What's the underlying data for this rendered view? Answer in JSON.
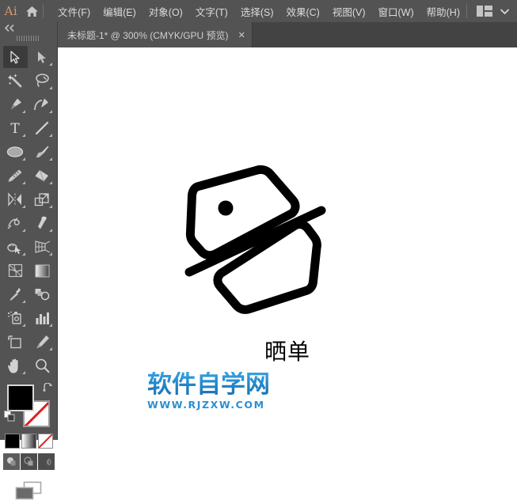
{
  "app": {
    "logo_text": "Ai",
    "home_icon": "home-icon",
    "title": "Adobe Illustrator"
  },
  "menubar": {
    "items": [
      {
        "label": "文件(F)",
        "name": "menu-file"
      },
      {
        "label": "编辑(E)",
        "name": "menu-edit"
      },
      {
        "label": "对象(O)",
        "name": "menu-object"
      },
      {
        "label": "文字(T)",
        "name": "menu-type"
      },
      {
        "label": "选择(S)",
        "name": "menu-select"
      },
      {
        "label": "效果(C)",
        "name": "menu-effect"
      },
      {
        "label": "视图(V)",
        "name": "menu-view"
      },
      {
        "label": "窗口(W)",
        "name": "menu-window"
      },
      {
        "label": "帮助(H)",
        "name": "menu-help"
      }
    ],
    "workspace_icon": "workspace-switcher-icon",
    "workspace_chevron": "chevron-down-icon",
    "bg_color": "#535353",
    "text_color": "#dcdcdc",
    "logo_color": "#d89a6c"
  },
  "tabbar": {
    "bg_color": "#434343",
    "tabs": [
      {
        "label": "未标题-1* @ 300% (CMYK/GPU 预览)",
        "close_glyph": "✕",
        "active": true
      }
    ]
  },
  "toolbar": {
    "collapse_glyph": "◀◀",
    "bg_color": "#535353",
    "active_tool": "selection-tool",
    "tools": [
      {
        "name": "selection-tool",
        "label": "选择工具",
        "corner": false,
        "active": true
      },
      {
        "name": "direct-selection-tool",
        "label": "直接选择工具",
        "corner": true,
        "active": false
      },
      {
        "name": "magic-wand-tool",
        "label": "魔棒工具",
        "corner": false,
        "active": false
      },
      {
        "name": "lasso-tool",
        "label": "套索工具",
        "corner": true,
        "active": false
      },
      {
        "name": "pen-tool",
        "label": "钢笔工具",
        "corner": true,
        "active": false
      },
      {
        "name": "curvature-tool",
        "label": "曲率工具",
        "corner": true,
        "active": false
      },
      {
        "name": "type-tool",
        "label": "文字工具",
        "corner": true,
        "active": false
      },
      {
        "name": "line-segment-tool",
        "label": "直线段工具",
        "corner": true,
        "active": false
      },
      {
        "name": "ellipse-tool",
        "label": "椭圆工具",
        "corner": true,
        "active": false
      },
      {
        "name": "paintbrush-tool",
        "label": "画笔工具",
        "corner": true,
        "active": false
      },
      {
        "name": "shaper-pencil-tool",
        "label": "铅笔工具",
        "corner": true,
        "active": false
      },
      {
        "name": "eraser-tool",
        "label": "橡皮擦工具",
        "corner": true,
        "active": false
      },
      {
        "name": "rotate-reflect-tool",
        "label": "旋转/镜像工具",
        "corner": true,
        "active": false
      },
      {
        "name": "scale-tool",
        "label": "比例缩放工具",
        "corner": true,
        "active": false
      },
      {
        "name": "width-warp-tool",
        "label": "宽度/变形工具",
        "corner": true,
        "active": false
      },
      {
        "name": "free-transform-tool",
        "label": "自由变换工具",
        "corner": true,
        "active": false
      },
      {
        "name": "shape-builder-tool",
        "label": "形状生成器工具",
        "corner": true,
        "active": false
      },
      {
        "name": "perspective-grid-tool",
        "label": "透视网格工具",
        "corner": true,
        "active": false
      },
      {
        "name": "mesh-tool",
        "label": "网格工具",
        "corner": false,
        "active": false
      },
      {
        "name": "gradient-tool",
        "label": "渐变工具",
        "corner": false,
        "active": false
      },
      {
        "name": "eyedropper-tool",
        "label": "吸管工具",
        "corner": true,
        "active": false
      },
      {
        "name": "blend-tool",
        "label": "混合工具",
        "corner": false,
        "active": false
      },
      {
        "name": "symbol-sprayer-tool",
        "label": "符号喷枪工具",
        "corner": true,
        "active": false
      },
      {
        "name": "column-graph-tool",
        "label": "柱形图工具",
        "corner": true,
        "active": false
      },
      {
        "name": "artboard-tool",
        "label": "画板工具",
        "corner": false,
        "active": false
      },
      {
        "name": "slice-tool",
        "label": "切片工具",
        "corner": true,
        "active": false
      },
      {
        "name": "hand-tool",
        "label": "抓手工具",
        "corner": true,
        "active": false
      },
      {
        "name": "zoom-tool",
        "label": "缩放工具",
        "corner": false,
        "active": false
      }
    ],
    "colors": {
      "fill_swatch": "#000000",
      "stroke_swatch": "#ffffff",
      "stroke_none_color": "#e02020",
      "swap_icon": "swap-fill-stroke-icon",
      "default_icon": "default-fill-stroke-icon"
    },
    "paint_modes": [
      {
        "name": "color-button",
        "label": "颜色",
        "active": true
      },
      {
        "name": "gradient-button",
        "label": "渐变",
        "active": false
      },
      {
        "name": "none-button",
        "label": "无",
        "active": false
      }
    ],
    "draw_modes": [
      {
        "name": "draw-normal-button",
        "label": "正常绘图",
        "active": true
      },
      {
        "name": "draw-behind-button",
        "label": "背面绘图",
        "active": false
      },
      {
        "name": "draw-inside-button",
        "label": "内部绘图",
        "active": false
      }
    ],
    "screen_mode": {
      "name": "screen-mode-button",
      "label": "更改屏幕模式"
    }
  },
  "canvas": {
    "bg_color": "#ffffff",
    "artwork": {
      "name": "shopping-tags-icon",
      "description": "两个重叠的标签图形",
      "stroke_color": "#000000"
    },
    "label": "晒单",
    "watermark": {
      "main": "软件自学网",
      "sub": "WWW.RJZXW.COM",
      "color": "#2288cc"
    }
  }
}
